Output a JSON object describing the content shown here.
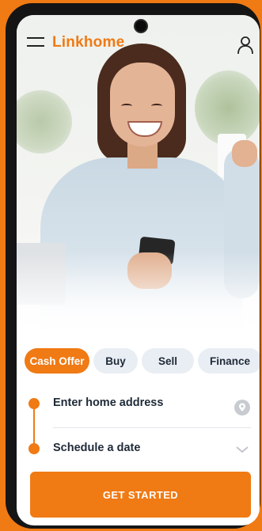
{
  "header": {
    "logo_text": "Linkhome",
    "menu_icon": "hamburger-menu-icon",
    "profile_icon": "user-icon"
  },
  "hero": {
    "image": "woman smiling at smartphone"
  },
  "tabs": [
    {
      "label": "Cash Offer",
      "active": true
    },
    {
      "label": "Buy",
      "active": false
    },
    {
      "label": "Sell",
      "active": false
    },
    {
      "label": "Finance",
      "active": false
    }
  ],
  "form": {
    "address_label": "Enter home address",
    "address_icon": "location-pin-icon",
    "date_label": "Schedule a date",
    "date_icon": "chevron-down-icon"
  },
  "cta": {
    "label": "GET STARTED"
  },
  "colors": {
    "accent": "#f07a14",
    "tab_inactive": "#e9eef4",
    "text_dark": "#1f2a38"
  }
}
